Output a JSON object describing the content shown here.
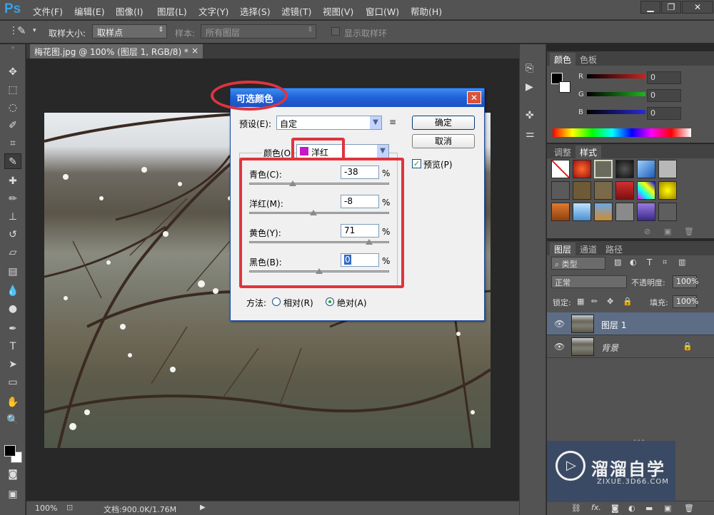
{
  "app": {
    "logo": "Ps"
  },
  "menu": [
    "文件(F)",
    "编辑(E)",
    "图像(I)",
    "图层(L)",
    "文字(Y)",
    "选择(S)",
    "滤镜(T)",
    "视图(V)",
    "窗口(W)",
    "帮助(H)"
  ],
  "window_controls": {
    "minimize": "▁",
    "restore": "❐",
    "close": "✕"
  },
  "options": {
    "sample_size_label": "取样大小:",
    "sample_size_value": "取样点",
    "sample_label": "样本:",
    "sample_value": "所有图层",
    "show_ring_label": "显示取样环"
  },
  "document": {
    "tab_title": "梅花图.jpg @ 100% (图层 1, RGB/8) *",
    "tab_close": "×"
  },
  "status": {
    "zoom": "100%",
    "doc_info": "文档:900.0K/1.76M"
  },
  "color_panel": {
    "tabs": [
      "颜色",
      "色板"
    ],
    "channels": [
      {
        "label": "R",
        "value": "0",
        "color": "#d41f1f"
      },
      {
        "label": "G",
        "value": "0",
        "color": "#1fb51f"
      },
      {
        "label": "B",
        "value": "0",
        "color": "#2a2ad8"
      }
    ]
  },
  "styles_panel": {
    "tabs": [
      "调整",
      "样式"
    ]
  },
  "layers_panel": {
    "tabs": [
      "图层",
      "通道",
      "路径"
    ],
    "filter_label": "类型",
    "blend_mode": "正常",
    "opacity_label": "不透明度:",
    "opacity_value": "100%",
    "lock_label": "锁定:",
    "fill_label": "填充:",
    "fill_value": "100%",
    "layers": [
      {
        "name": "图层 1",
        "selected": true
      },
      {
        "name": "背景",
        "locked": true
      }
    ]
  },
  "dialog": {
    "title": "可选颜色",
    "close": "✕",
    "preset_label": "预设(E):",
    "preset_value": "自定",
    "colors_label": "颜色(O",
    "colors_value": "洋红",
    "colors_swatch": "#c617c6",
    "ok": "确定",
    "cancel": "取消",
    "preview_label": "预览(P)",
    "preview_checked": true,
    "sliders": [
      {
        "label": "青色(C):",
        "value": "-38",
        "unit": "%",
        "amount": -38
      },
      {
        "label": "洋红(M):",
        "value": "-8",
        "unit": "%",
        "amount": -8
      },
      {
        "label": "黄色(Y):",
        "value": "71",
        "unit": "%",
        "amount": 71
      },
      {
        "label": "黑色(B):",
        "value": "0",
        "unit": "%",
        "amount": 0
      }
    ],
    "method_label": "方法:",
    "method_relative": "相对(R)",
    "method_absolute": "绝对(A)",
    "method_selected": "absolute"
  },
  "watermark": {
    "brand": "溜溜自学",
    "url": "ZIXUE.3D66.COM"
  },
  "accent": "#e0343e"
}
